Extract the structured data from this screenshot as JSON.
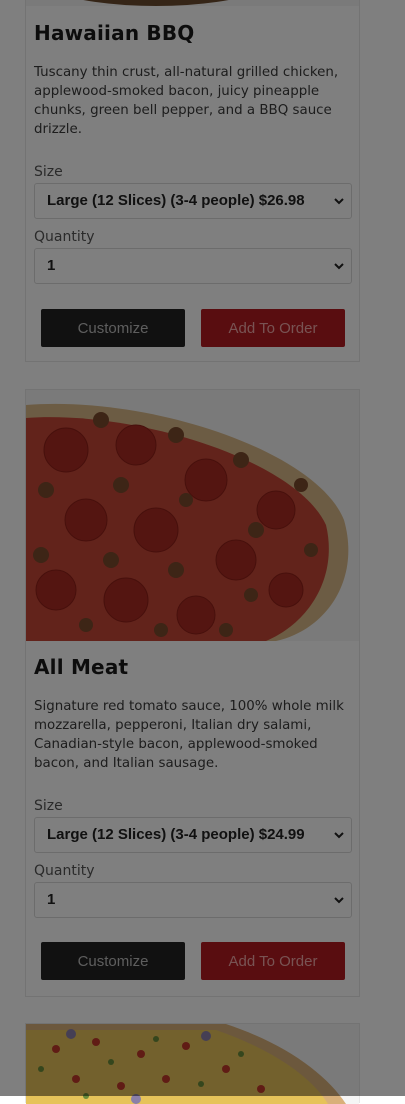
{
  "products": [
    {
      "name": "Hawaiian BBQ",
      "description": "Tuscany thin crust, all-natural grilled chicken, applewood-smoked bacon, juicy pineapple chunks, green bell pepper, and a BBQ sauce drizzle.",
      "size_label": "Size",
      "size_selected": "Large (12 Slices) (3-4 people) $26.98",
      "quantity_label": "Quantity",
      "quantity_selected": "1",
      "customize_label": "Customize",
      "add_label": "Add To Order"
    },
    {
      "name": "All Meat",
      "description": "Signature red tomato sauce, 100% whole milk mozzarella, pepperoni, Italian dry salami, Canadian-style bacon, applewood-smoked bacon, and Italian sausage.",
      "size_label": "Size",
      "size_selected": "Large (12 Slices) (3-4 people) $24.99",
      "quantity_label": "Quantity",
      "quantity_selected": "1",
      "customize_label": "Customize",
      "add_label": "Add To Order"
    }
  ],
  "colors": {
    "customize_button": "#222222",
    "add_button": "#b31b21",
    "overlay": "rgba(0,0,0,0.5)"
  }
}
